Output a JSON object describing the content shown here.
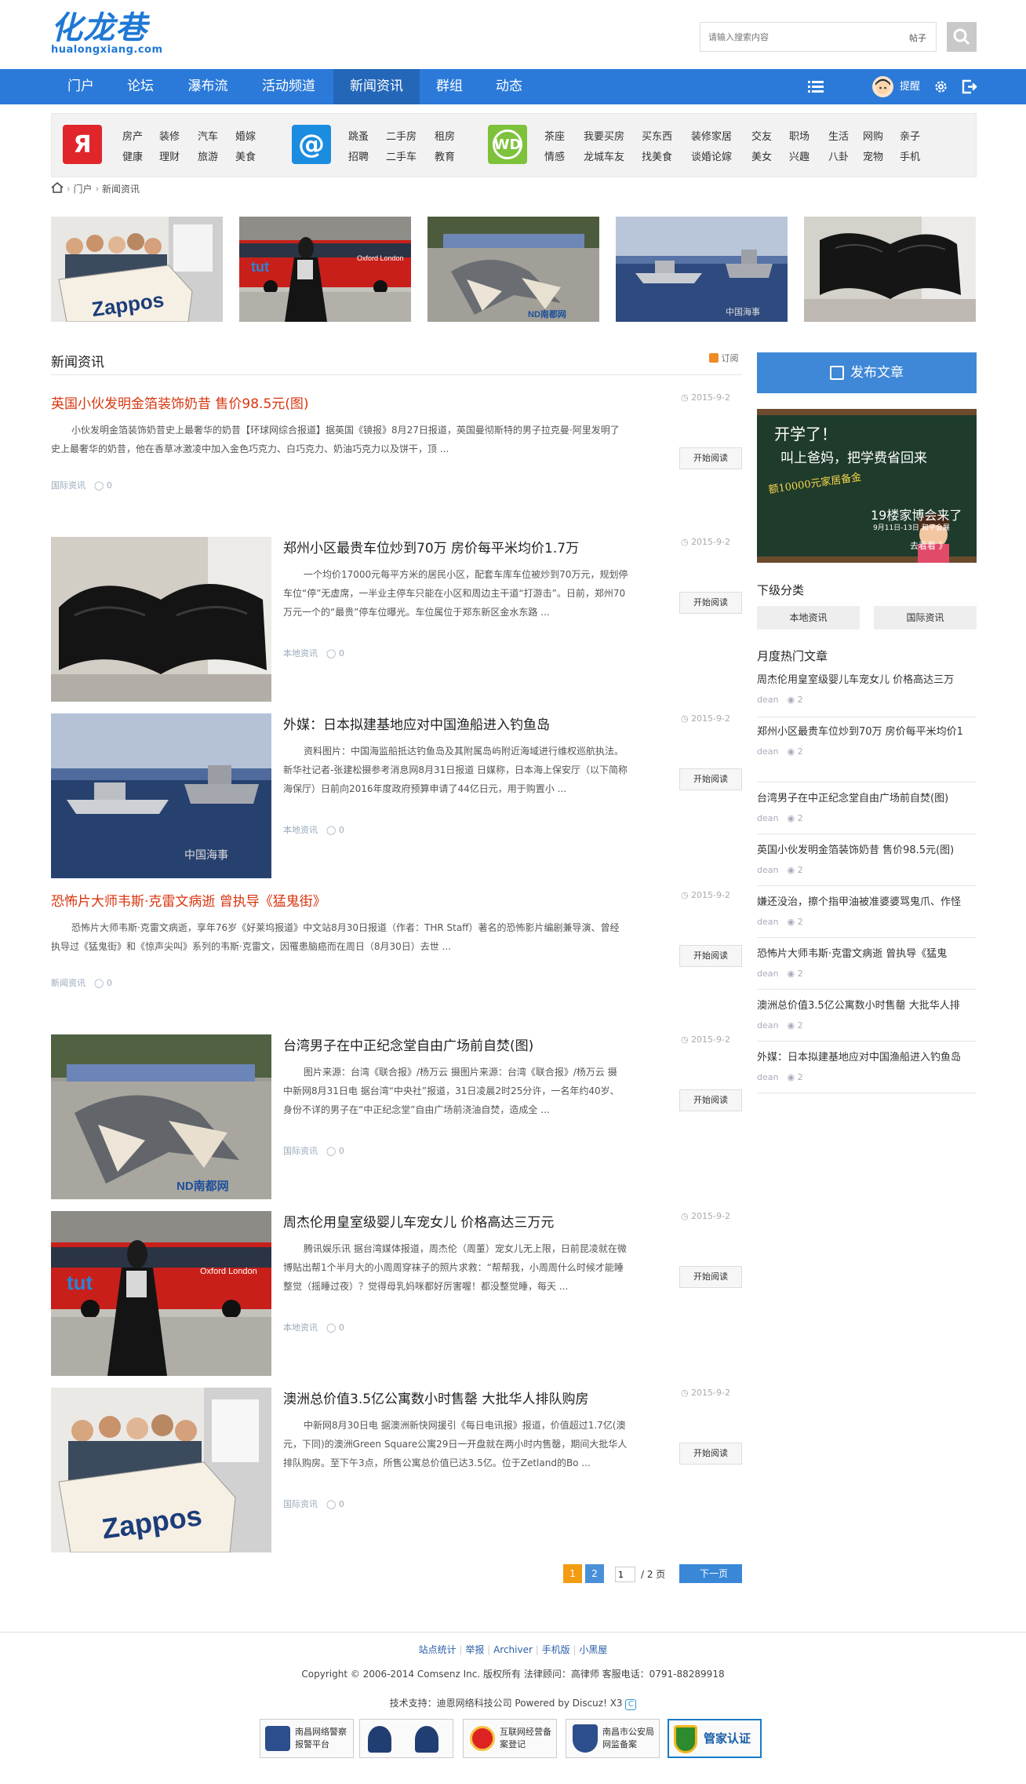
{
  "site": {
    "logo_text": "化龙巷",
    "logo_sub": "hualongxiang.com",
    "search_placeholder": "请输入搜索内容",
    "search_type": "帖子"
  },
  "nav": {
    "items": [
      "门户",
      "论坛",
      "瀑布流",
      "活动频道",
      "新闻资讯",
      "群组",
      "动态"
    ],
    "active_index": 4,
    "remind": "提醒"
  },
  "categories": {
    "g1": [
      [
        "房产",
        "装修",
        "汽车",
        "婚嫁"
      ],
      [
        "健康",
        "理财",
        "旅游",
        "美食"
      ]
    ],
    "g2": [
      [
        "跳蚤",
        "二手房",
        "租房"
      ],
      [
        "招聘",
        "二手车",
        "教育"
      ]
    ],
    "g3": [
      [
        "茶座",
        "我要买房",
        "买东西",
        "装修家居",
        "交友",
        "职场",
        "生活",
        "网购",
        "亲子"
      ],
      [
        "情感",
        "龙城车友",
        "找美食",
        "谈婚论嫁",
        "美女",
        "兴趣",
        "八卦",
        "宠物",
        "手机"
      ]
    ]
  },
  "breadcrumb": [
    "门户",
    "新闻资讯"
  ],
  "section": {
    "title": "新闻资讯",
    "rss": "订阅"
  },
  "articles": [
    {
      "title": "英国小伙发明金箔装饰奶昔 售价98.5元(图)",
      "red": true,
      "date": "2015-9-2",
      "summary": "小伙发明金箔装饰奶昔史上最奢华的奶昔【环球网综合报道】据英国《镜报》8月27日报道，英国曼彻斯特的男子拉克曼·阿里发明了史上最奢华的奶昔，他在香草冰激凌中加入金色巧克力、白巧克力、奶油巧克力以及饼干，顶 ...",
      "category": "国际资讯",
      "comments": "0",
      "button": "开始阅读"
    },
    {
      "title": "郑州小区最贵车位炒到70万 房价每平米均价1.7万",
      "red": false,
      "date": "2015-9-2",
      "summary": "一个均价17000元每平方米的居民小区，配套车库车位被炒到70万元，规划停车位“停”无虚席，一半业主停车只能在小区和周边主干道“打游击”。日前，郑州70万元一个的“最贵”停车位曝光。车位属位于郑东新区金水东路 ...",
      "category": "本地资讯",
      "comments": "0",
      "button": "开始阅读"
    },
    {
      "title": "外媒：日本拟建基地应对中国渔船进入钓鱼岛",
      "red": false,
      "date": "2015-9-2",
      "summary": "资料图片：中国海监船抵达钓鱼岛及其附属岛屿附近海域进行维权巡航执法。新华社记者-张建松摄参考消息网8月31日报道 日媒称，日本海上保安厅（以下简称海保厅）日前向2016年度政府预算申请了44亿日元，用于购置小 ...",
      "category": "本地资讯",
      "comments": "0",
      "button": "开始阅读"
    },
    {
      "title": "恐怖片大师韦斯·克雷文病逝 曾执导《猛鬼街》",
      "red": true,
      "date": "2015-9-2",
      "summary": "恐怖片大师韦斯·克雷文病逝，享年76岁《好莱坞报道》中文站8月30日报道（作者：THR Staff）著名的恐怖影片编剧兼导演、曾经执导过《猛鬼街》和《惊声尖叫》系列的韦斯·克雷文，因罹患脑癌而在周日（8月30日）去世 ...",
      "category": "新闻资讯",
      "comments": "0",
      "button": "开始阅读"
    },
    {
      "title": "台湾男子在中正纪念堂自由广场前自焚(图)",
      "red": false,
      "date": "2015-9-2",
      "summary": "图片来源：台湾《联合报》/杨万云 摄图片来源：台湾《联合报》/杨万云 摄　　中新网8月31日电 据台湾“中央社”报道，31日凌晨2时25分许，一名年约40岁、身份不详的男子在“中正纪念堂”自由广场前浇油自焚，造成全 ...",
      "category": "国际资讯",
      "comments": "0",
      "button": "开始阅读"
    },
    {
      "title": "周杰伦用皇室级婴儿车宠女儿 价格高达三万元",
      "red": false,
      "date": "2015-9-2",
      "summary": "腾讯娱乐讯 据台湾媒体报道，周杰伦（周董）宠女儿无上限，日前昆凌就在微博贴出帮1个半月大的小周周穿袜子的照片求救：“帮帮我，小周周什么时候才能睡整觉（摇睡过夜）？觉得母乳妈咪都好厉害喔！都没整觉睡，每天 ...",
      "category": "本地资讯",
      "comments": "0",
      "button": "开始阅读"
    },
    {
      "title": "澳洲总价值3.5亿公寓数小时售罄 大批华人排队购房",
      "red": false,
      "date": "2015-9-2",
      "summary": "中新网8月30日电 据澳洲新快网援引《每日电讯报》报道，价值超过1.7亿(澳元，下同)的澳洲Green Square公寓29日一开盘就在两小时内售罄，期间大批华人排队购房。至下午3点，所售公寓总价值已达3.5亿。位于Zetland的Bo ...",
      "category": "国际资讯",
      "comments": "0",
      "button": "开始阅读"
    }
  ],
  "pagination": {
    "pages": [
      "1",
      "2"
    ],
    "current": "1",
    "input_value": "1",
    "total_text": "/ 2 页",
    "next": "下一页"
  },
  "sidebar": {
    "publish": "发布文章",
    "banner": {
      "line1": "开学了！",
      "line2": "叫上爸妈，把学费省回来",
      "line3": "额10000元家居备金",
      "line4": "19楼家博会来了",
      "line5": "9月11日-13日 和平会展",
      "cta": "去看看 》"
    },
    "subcat_title": "下级分类",
    "subcats": [
      "本地资讯",
      "国际资讯"
    ],
    "hot_title": "月度热门文章",
    "hot": [
      {
        "title": "周杰伦用皇室级婴儿车宠女儿 价格高达三万",
        "author": "dean",
        "views": "2"
      },
      {
        "title": "郑州小区最贵车位炒到70万 房价每平米均价1",
        "author": "dean",
        "views": "2"
      },
      {
        "title": "台湾男子在中正纪念堂自由广场前自焚(图)",
        "author": "dean",
        "views": "2"
      },
      {
        "title": "英国小伙发明金箔装饰奶昔 售价98.5元(图)",
        "author": "dean",
        "views": "2"
      },
      {
        "title": "嫌还没治，擦个指甲油被准婆婆骂鬼爪、作怪",
        "author": "dean",
        "views": "2"
      },
      {
        "title": "恐怖片大师韦斯·克雷文病逝 曾执导《猛鬼",
        "author": "dean",
        "views": "2"
      },
      {
        "title": "澳洲总价值3.5亿公寓数小时售罄 大批华人排",
        "author": "dean",
        "views": "2"
      },
      {
        "title": "外媒：日本拟建基地应对中国渔船进入钓鱼岛",
        "author": "dean",
        "views": "2"
      }
    ]
  },
  "footer": {
    "links": [
      "站点统计",
      "举报",
      "Archiver",
      "手机版",
      "小黑屋"
    ],
    "copyright": "Copyright © 2006-2014  Comsenz Inc. 版权所有  法律顾问：高律师  客服电话：0791-88289918",
    "support": "技术支持：迪恩网络科技公司  Powered by Discuz! X3",
    "badges": [
      "南昌网络警察报警平台",
      "",
      "互联网经营备案登记",
      "南昌市公安局网监备案",
      "管家认证"
    ]
  },
  "colors": {
    "brand": "#2b7ad9",
    "red_title": "#d8350f",
    "active_nav": "#2467b8"
  }
}
